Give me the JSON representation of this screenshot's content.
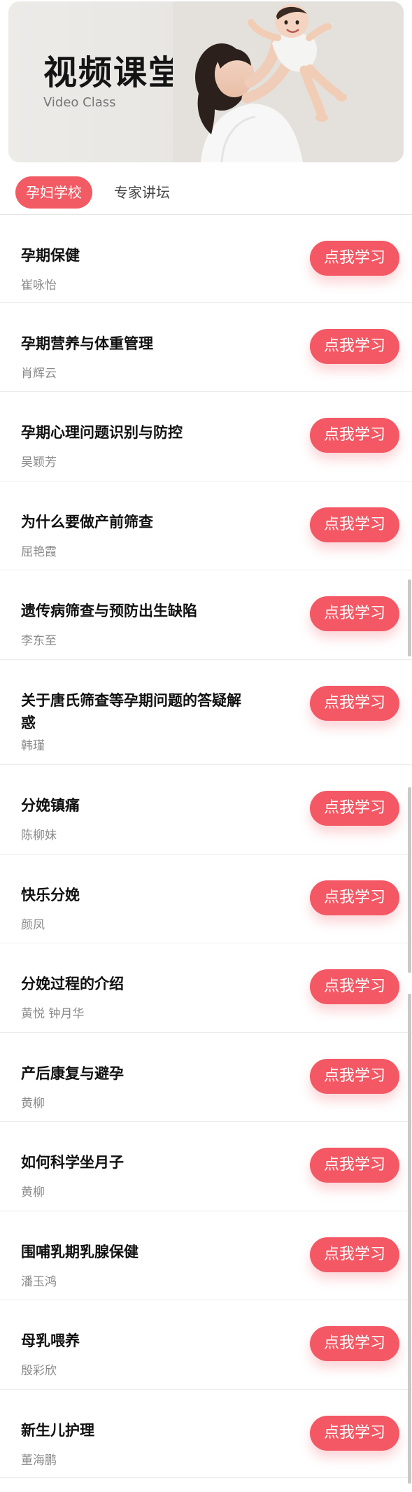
{
  "banner": {
    "title": "视频课堂",
    "subtitle": "Video Class"
  },
  "tabs": [
    {
      "label": "孕妇学校",
      "active": true
    },
    {
      "label": "专家讲坛",
      "active": false
    }
  ],
  "courses": [
    {
      "title": "孕期保健",
      "author": "崔咏怡"
    },
    {
      "title": "孕期营养与体重管理",
      "author": "肖辉云"
    },
    {
      "title": "孕期心理问题识别与防控",
      "author": "吴颖芳"
    },
    {
      "title": "为什么要做产前筛查",
      "author": "屈艳霞"
    },
    {
      "title": "遗传病筛查与预防出生缺陷",
      "author": "李东至"
    },
    {
      "title": "关于唐氏筛查等孕期问题的答疑解惑",
      "author": "韩瑾"
    },
    {
      "title": "分娩镇痛",
      "author": "陈柳妹"
    },
    {
      "title": "快乐分娩",
      "author": "颜凤"
    },
    {
      "title": "分娩过程的介绍",
      "author": "黄悦 钟月华"
    },
    {
      "title": "产后康复与避孕",
      "author": "黄柳"
    },
    {
      "title": "如何科学坐月子",
      "author": "黄柳"
    },
    {
      "title": "围哺乳期乳腺保健",
      "author": "潘玉鸿"
    },
    {
      "title": "母乳喂养",
      "author": "殷彩欣"
    },
    {
      "title": "新生儿护理",
      "author": "董海鹏"
    }
  ],
  "study_button_label": "点我学习",
  "colors": {
    "accent": "#f35864",
    "tab_active_bg": "#f25a64",
    "author_text": "#8a8a8a"
  }
}
